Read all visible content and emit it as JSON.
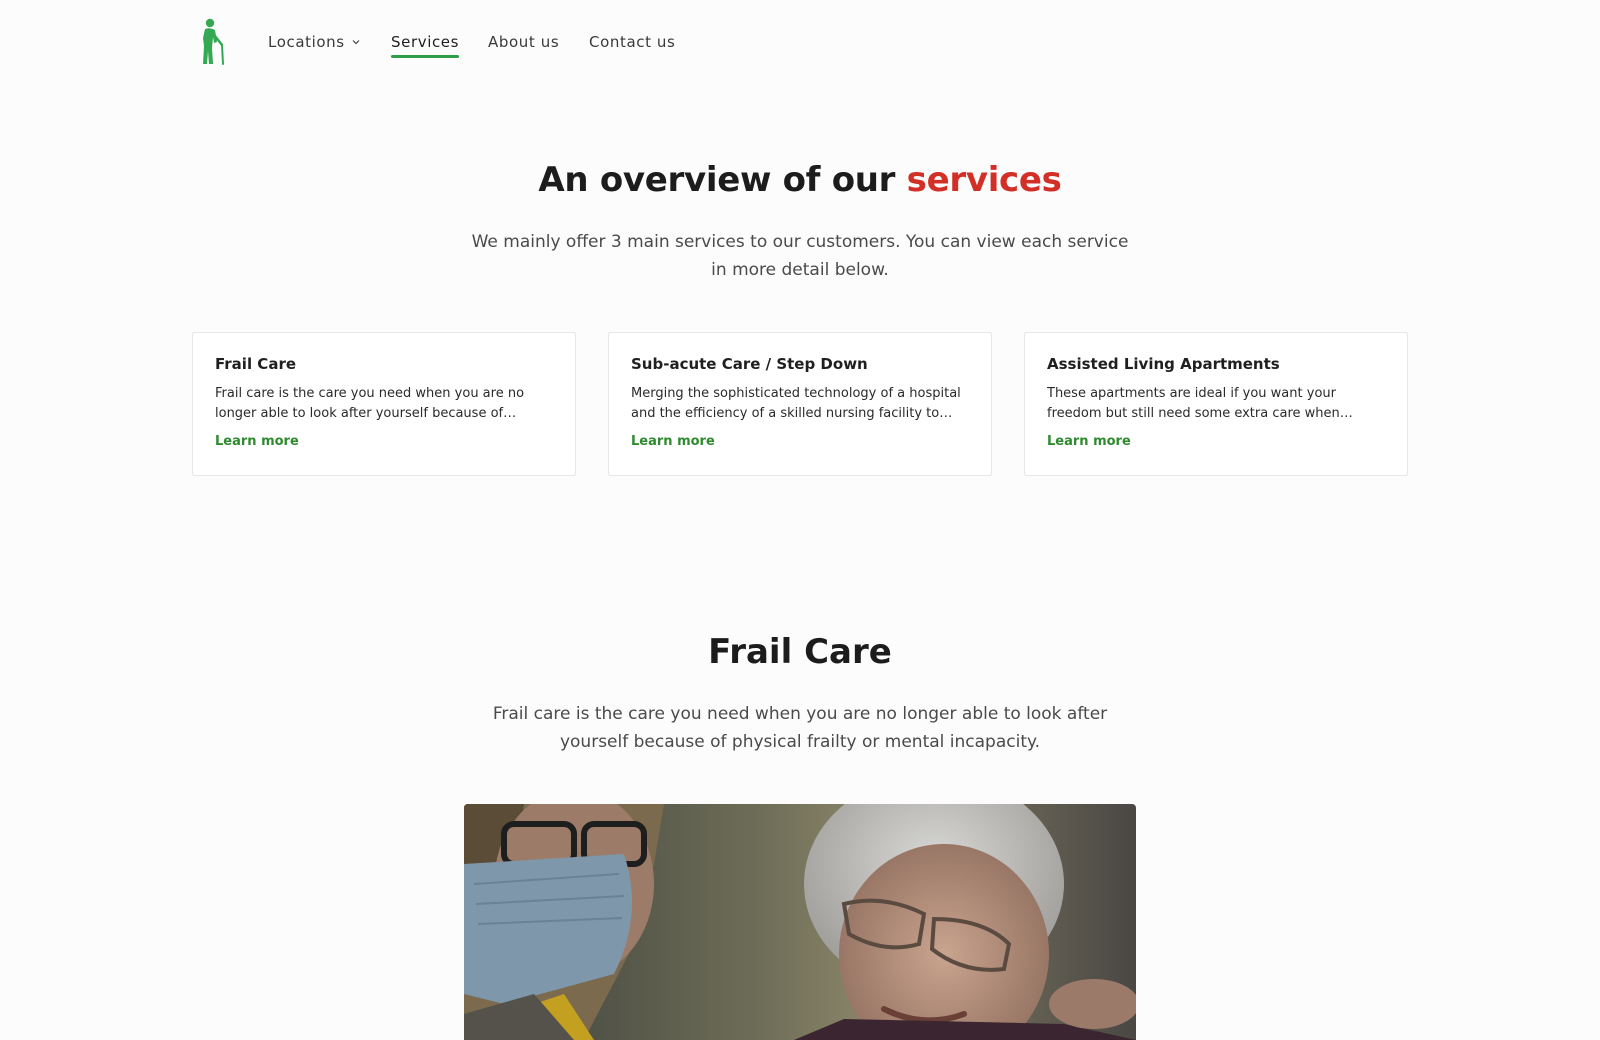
{
  "nav": {
    "logo_icon": "elderly-person-with-cane-icon",
    "items": [
      {
        "label": "Locations",
        "has_dropdown": true
      },
      {
        "label": "Services",
        "active": true
      },
      {
        "label": "About us"
      },
      {
        "label": "Contact us"
      }
    ]
  },
  "overview": {
    "title_prefix": "An overview of our ",
    "title_accent": "services",
    "subtitle": "We mainly offer 3 main services to our customers. You can view each service in more detail below."
  },
  "cards": [
    {
      "title": "Frail Care",
      "description": "Frail care is the care you need when you are no longer able to look after yourself because of physical frailty or mental incapacity.",
      "link": "Learn more"
    },
    {
      "title": "Sub-acute Care / Step Down",
      "description": "Merging the sophisticated technology of a hospital and the efficiency of a skilled nursing facility to provide care.",
      "link": "Learn more"
    },
    {
      "title": "Assisted Living Apartments",
      "description": "These apartments are ideal if you want your freedom but still need some extra care when needed.",
      "link": "Learn more"
    }
  ],
  "frail_care": {
    "title": "Frail Care",
    "subtitle": "Frail care is the care you need when you are no longer able to look after yourself because of physical frailty or mental incapacity."
  },
  "colors": {
    "brand_green": "#2f9e44",
    "accent_red": "#d22f27",
    "link_green": "#2f8a2f"
  }
}
